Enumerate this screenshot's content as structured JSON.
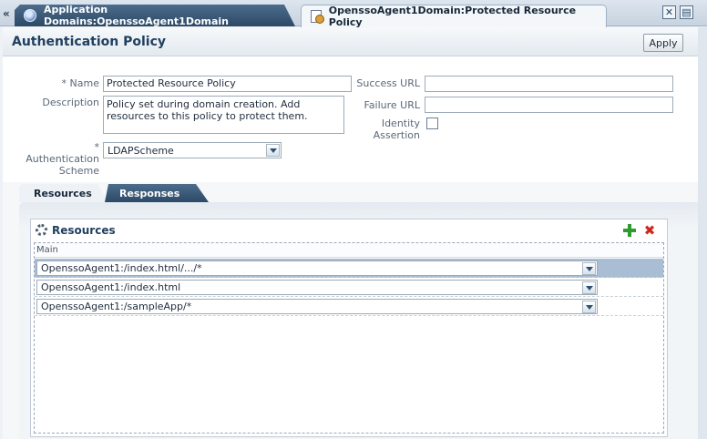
{
  "tabs": [
    {
      "label": "Application Domains:OpenssoAgent1Domain",
      "icon": "globe-icon"
    },
    {
      "label": "OpenssoAgent1Domain:Protected Resource Policy",
      "icon": "policy-document-icon"
    }
  ],
  "nav_back": "«",
  "panel": {
    "title": "Authentication Policy",
    "apply_label": "Apply"
  },
  "form": {
    "name_label": "Name",
    "name_value": "Protected Resource Policy",
    "description_label": "Description",
    "description_value": "Policy set during domain creation. Add resources to this policy to protect them.",
    "auth_scheme_label_1": "Authentication",
    "auth_scheme_label_2": "Scheme",
    "auth_scheme_value": "LDAPScheme",
    "required_marker": "*",
    "success_url_label": "Success URL",
    "success_url_value": "",
    "failure_url_label": "Failure URL",
    "failure_url_value": "",
    "identity_assertion_label_1": "Identity",
    "identity_assertion_label_2": "Assertion",
    "identity_assertion_checked": false
  },
  "lower_tabs": [
    {
      "label": "Resources",
      "selected": true
    },
    {
      "label": "Responses",
      "selected": false
    }
  ],
  "resources": {
    "title": "Resources",
    "column_header": "Main",
    "rows": [
      {
        "value": "OpenssoAgent1:/index.html/.../*",
        "selected": true
      },
      {
        "value": "OpenssoAgent1:/index.html",
        "selected": false
      },
      {
        "value": "OpenssoAgent1:/sampleApp/*",
        "selected": false
      }
    ]
  },
  "colors": {
    "accent": "#2c4966",
    "selected_row": "#a9bdd4",
    "add_icon": "#2d9b2f",
    "delete_icon": "#d1261c"
  }
}
